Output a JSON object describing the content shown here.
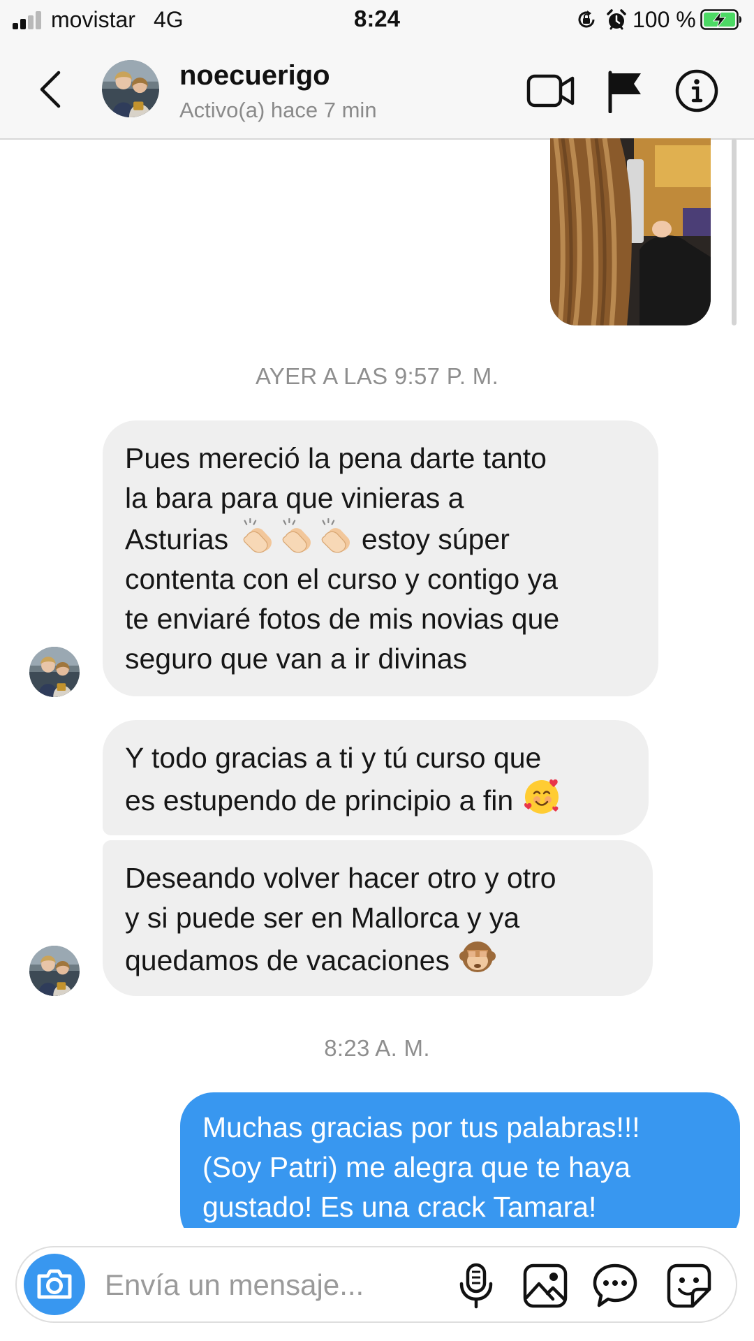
{
  "status_bar": {
    "carrier": "movistar",
    "network": "4G",
    "time": "8:24",
    "battery": "100 %",
    "icons": [
      "signal-icon",
      "orientation-lock-icon",
      "alarm-icon",
      "battery-charging-icon"
    ],
    "battery_color": "#4cd964"
  },
  "header": {
    "username": "noecuerigo",
    "presence": "Activo(a) hace 7 min",
    "icons": [
      "back-icon",
      "video-call-icon",
      "flag-icon",
      "info-icon"
    ]
  },
  "messages": [
    {
      "type": "timestamp",
      "text": "AYER A LAS 9:57 P. M."
    },
    {
      "type": "received",
      "lines": [
        "Pues mereció la pena darte tanto",
        "la bara para que vinieras a",
        "Asturias",
        "estoy súper",
        "contenta con el curso y contigo ya",
        "te enviaré fotos de mis novias que",
        "seguro que van a ir divinas"
      ],
      "emoji": "clapping-hands-emoji ×3"
    },
    {
      "type": "received",
      "lines": [
        "Y todo gracias a ti y tú curso que",
        "es estupendo de principio a fin"
      ],
      "emoji": "smiling-face-with-hearts-emoji"
    },
    {
      "type": "received",
      "lines": [
        "Deseando volver hacer otro y otro",
        "y si puede ser en Mallorca y ya",
        "quedamos de vacaciones"
      ],
      "emoji": "see-no-evil-monkey-emoji"
    },
    {
      "type": "timestamp",
      "text": "8:23 A. M."
    },
    {
      "type": "sent",
      "lines": [
        "Muchas gracias por tus palabras!!!",
        "(Soy Patri) me alegra que te haya",
        "gustado! Es una crack Tamara!"
      ]
    }
  ],
  "composer": {
    "placeholder": "Envía un mensaje...",
    "icons": [
      "camera-icon",
      "microphone-icon",
      "gallery-icon",
      "message-options-icon",
      "sticker-icon"
    ]
  },
  "colors": {
    "accent": "#3897f0",
    "received_bubble": "#efefef",
    "secondary_text": "#8e8e8e"
  }
}
